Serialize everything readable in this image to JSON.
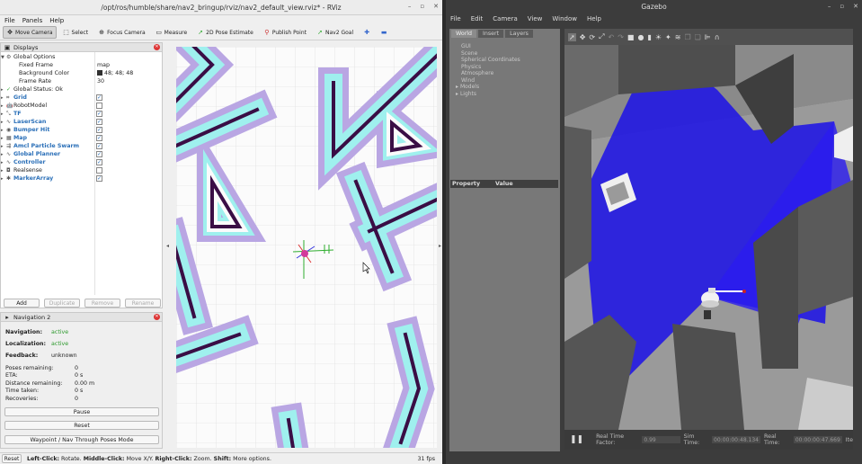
{
  "rviz": {
    "title": "/opt/ros/humble/share/nav2_bringup/rviz/nav2_default_view.rviz* - RViz",
    "menus": [
      "File",
      "Panels",
      "Help"
    ],
    "tools": [
      "Move Camera",
      "Select",
      "Focus Camera",
      "Measure",
      "2D Pose Estimate",
      "Publish Point",
      "Nav2 Goal"
    ],
    "displays": {
      "title": "Displays",
      "global_options": "Global Options",
      "fixed_frame_label": "Fixed Frame",
      "fixed_frame_value": "map",
      "bg_label": "Background Color",
      "bg_value": "48; 48; 48",
      "frame_rate_label": "Frame Rate",
      "frame_rate_value": "30",
      "global_status": "Global Status: Ok",
      "items": [
        {
          "name": "Grid",
          "checked": true,
          "bold": true
        },
        {
          "name": "RobotModel",
          "checked": false,
          "bold": false
        },
        {
          "name": "TF",
          "checked": true,
          "bold": true
        },
        {
          "name": "LaserScan",
          "checked": true,
          "bold": true
        },
        {
          "name": "Bumper Hit",
          "checked": true,
          "bold": true
        },
        {
          "name": "Map",
          "checked": true,
          "bold": true
        },
        {
          "name": "Amcl Particle Swarm",
          "checked": true,
          "bold": true
        },
        {
          "name": "Global Planner",
          "checked": true,
          "bold": true
        },
        {
          "name": "Controller",
          "checked": true,
          "bold": true
        },
        {
          "name": "Realsense",
          "checked": false,
          "bold": false
        },
        {
          "name": "MarkerArray",
          "checked": true,
          "bold": true
        }
      ],
      "buttons": [
        "Add",
        "Duplicate",
        "Remove",
        "Rename"
      ]
    },
    "navigation": {
      "title": "Navigation 2",
      "navigation_label": "Navigation:",
      "navigation_value": "active",
      "localization_label": "Localization:",
      "localization_value": "active",
      "feedback_label": "Feedback:",
      "feedback_value": "unknown",
      "poses_label": "Poses remaining:",
      "poses_value": "0",
      "eta_label": "ETA:",
      "eta_value": "0 s",
      "distance_label": "Distance remaining:",
      "distance_value": "0.00 m",
      "time_label": "Time taken:",
      "time_value": "0 s",
      "recoveries_label": "Recoveries:",
      "recoveries_value": "0",
      "pause": "Pause",
      "reset": "Reset",
      "waypoint": "Waypoint / Nav Through Poses Mode"
    },
    "status": {
      "reset": "Reset",
      "left": "Left-Click:",
      "left_t": "Rotate.",
      "middle": "Middle-Click:",
      "middle_t": "Move X/Y.",
      "right": "Right-Click:",
      "right_t": "Zoom.",
      "shift": "Shift:",
      "shift_t": "More options.",
      "fps": "31 fps"
    }
  },
  "gazebo": {
    "title": "Gazebo",
    "menus": [
      "File",
      "Edit",
      "Camera",
      "View",
      "Window",
      "Help"
    ],
    "tabs": [
      "World",
      "Insert",
      "Layers"
    ],
    "tree": [
      "GUI",
      "Scene",
      "Spherical Coordinates",
      "Physics",
      "Atmosphere",
      "Wind",
      "Models",
      "Lights"
    ],
    "prop_header": "Property",
    "value_header": "Value",
    "rtf_label": "Real Time Factor:",
    "rtf_value": "0.99",
    "sim_label": "Sim Time:",
    "sim_value": "00:00:00:48.134",
    "real_label": "Real Time:",
    "real_value": "00:00:00:47.669",
    "iter_label": "Ite"
  }
}
